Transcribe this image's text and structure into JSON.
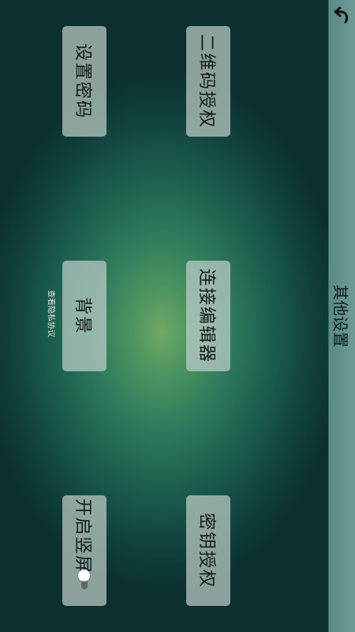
{
  "header": {
    "title": "其他设置",
    "back_icon": "back-arrow-icon"
  },
  "tiles": {
    "qr_auth": "二维码授权",
    "set_password": "设置密码",
    "connect_editor": "连接编辑器",
    "background": "背景",
    "key_auth": "密钥授权",
    "portrait": "开启竖屏"
  },
  "privacy_link": "查看隐私协议",
  "portrait_toggle": {
    "on": false
  }
}
